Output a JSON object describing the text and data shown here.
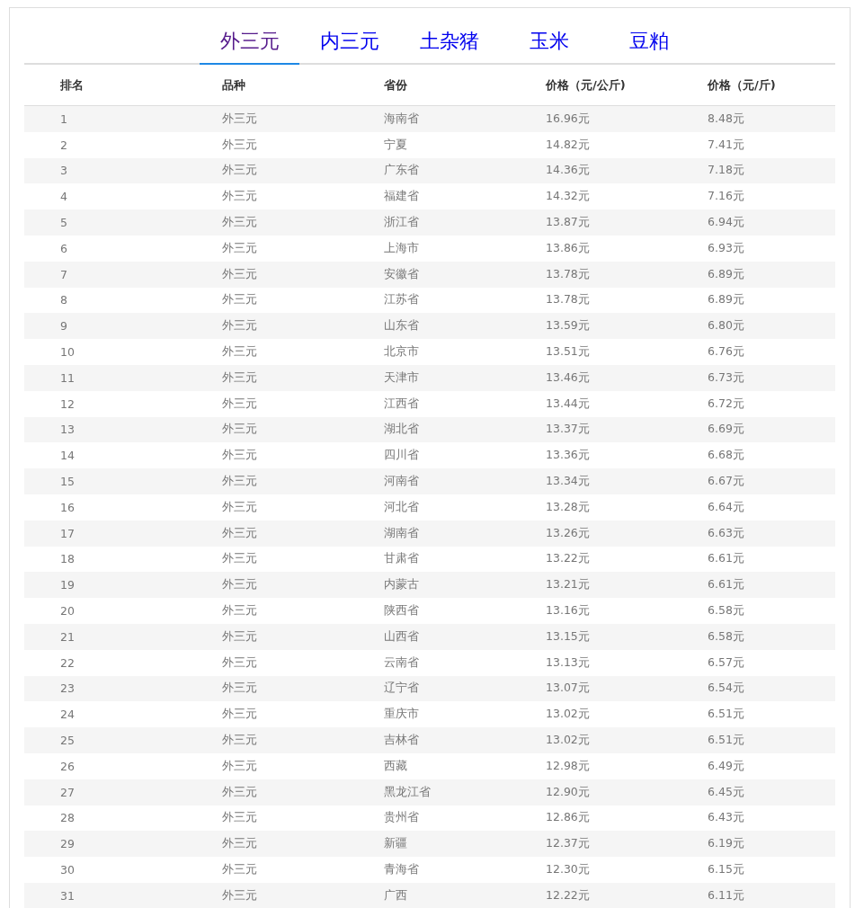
{
  "tabs": [
    {
      "label": "外三元",
      "selected": true
    },
    {
      "label": "内三元",
      "selected": false
    },
    {
      "label": "土杂猪",
      "selected": false
    },
    {
      "label": "玉米",
      "selected": false
    },
    {
      "label": "豆粕",
      "selected": false
    }
  ],
  "table": {
    "columns": [
      "排名",
      "品种",
      "省份",
      "价格（元/公斤)",
      "价格（元/斤)"
    ],
    "rows": [
      [
        "1",
        "外三元",
        "海南省",
        "16.96元",
        "8.48元"
      ],
      [
        "2",
        "外三元",
        "宁夏",
        "14.82元",
        "7.41元"
      ],
      [
        "3",
        "外三元",
        "广东省",
        "14.36元",
        "7.18元"
      ],
      [
        "4",
        "外三元",
        "福建省",
        "14.32元",
        "7.16元"
      ],
      [
        "5",
        "外三元",
        "浙江省",
        "13.87元",
        "6.94元"
      ],
      [
        "6",
        "外三元",
        "上海市",
        "13.86元",
        "6.93元"
      ],
      [
        "7",
        "外三元",
        "安徽省",
        "13.78元",
        "6.89元"
      ],
      [
        "8",
        "外三元",
        "江苏省",
        "13.78元",
        "6.89元"
      ],
      [
        "9",
        "外三元",
        "山东省",
        "13.59元",
        "6.80元"
      ],
      [
        "10",
        "外三元",
        "北京市",
        "13.51元",
        "6.76元"
      ],
      [
        "11",
        "外三元",
        "天津市",
        "13.46元",
        "6.73元"
      ],
      [
        "12",
        "外三元",
        "江西省",
        "13.44元",
        "6.72元"
      ],
      [
        "13",
        "外三元",
        "湖北省",
        "13.37元",
        "6.69元"
      ],
      [
        "14",
        "外三元",
        "四川省",
        "13.36元",
        "6.68元"
      ],
      [
        "15",
        "外三元",
        "河南省",
        "13.34元",
        "6.67元"
      ],
      [
        "16",
        "外三元",
        "河北省",
        "13.28元",
        "6.64元"
      ],
      [
        "17",
        "外三元",
        "湖南省",
        "13.26元",
        "6.63元"
      ],
      [
        "18",
        "外三元",
        "甘肃省",
        "13.22元",
        "6.61元"
      ],
      [
        "19",
        "外三元",
        "内蒙古",
        "13.21元",
        "6.61元"
      ],
      [
        "20",
        "外三元",
        "陕西省",
        "13.16元",
        "6.58元"
      ],
      [
        "21",
        "外三元",
        "山西省",
        "13.15元",
        "6.58元"
      ],
      [
        "22",
        "外三元",
        "云南省",
        "13.13元",
        "6.57元"
      ],
      [
        "23",
        "外三元",
        "辽宁省",
        "13.07元",
        "6.54元"
      ],
      [
        "24",
        "外三元",
        "重庆市",
        "13.02元",
        "6.51元"
      ],
      [
        "25",
        "外三元",
        "吉林省",
        "13.02元",
        "6.51元"
      ],
      [
        "26",
        "外三元",
        "西藏",
        "12.98元",
        "6.49元"
      ],
      [
        "27",
        "外三元",
        "黑龙江省",
        "12.90元",
        "6.45元"
      ],
      [
        "28",
        "外三元",
        "贵州省",
        "12.86元",
        "6.43元"
      ],
      [
        "29",
        "外三元",
        "新疆",
        "12.37元",
        "6.19元"
      ],
      [
        "30",
        "外三元",
        "青海省",
        "12.30元",
        "6.15元"
      ],
      [
        "31",
        "外三元",
        "广西",
        "12.22元",
        "6.11元"
      ]
    ]
  }
}
